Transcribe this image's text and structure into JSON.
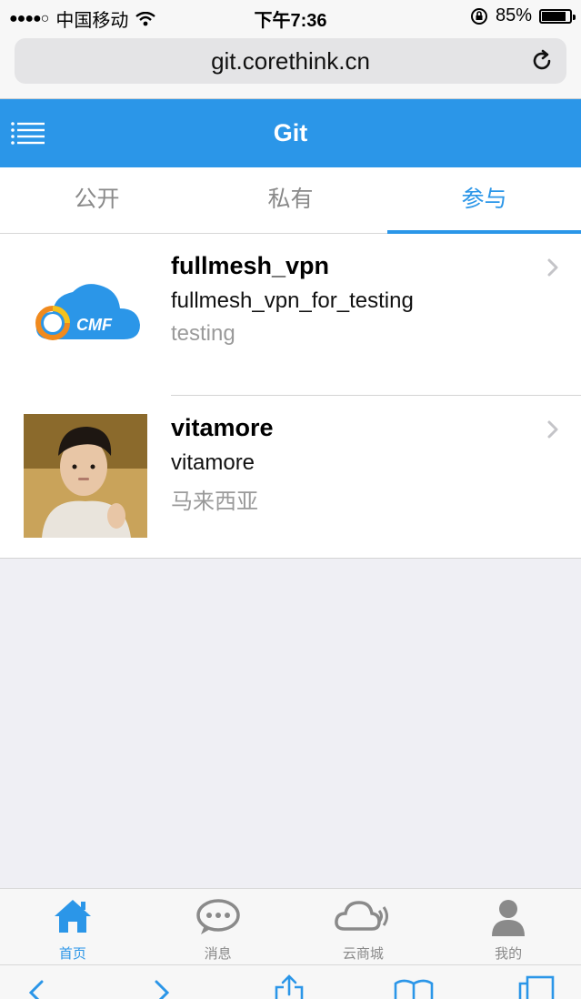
{
  "status_bar": {
    "signal": "●●●●○",
    "carrier": "中国移动",
    "time": "下午7:36",
    "battery": "85%",
    "battery_level": 0.85
  },
  "browser": {
    "url": "git.corethink.cn"
  },
  "app_bar": {
    "title": "Git",
    "accent": "#2b96e8"
  },
  "tabs": [
    {
      "label": "公开",
      "active": false
    },
    {
      "label": "私有",
      "active": false
    },
    {
      "label": "参与",
      "active": true
    }
  ],
  "repos": [
    {
      "name": "fullmesh_vpn",
      "description": "fullmesh_vpn_for_testing",
      "meta": "testing",
      "thumb_text": "CMF",
      "thumb_type": "cmf-logo"
    },
    {
      "name": "vitamore",
      "description": "vitamore",
      "meta": "马来西亚",
      "thumb_type": "avatar-photo"
    }
  ],
  "tab_bar": [
    {
      "label": "首页",
      "icon": "home-icon",
      "active": true
    },
    {
      "label": "消息",
      "icon": "chat-bubble-icon",
      "active": false
    },
    {
      "label": "云商城",
      "icon": "cloud-icon",
      "active": false
    },
    {
      "label": "我的",
      "icon": "user-icon",
      "active": false
    }
  ]
}
